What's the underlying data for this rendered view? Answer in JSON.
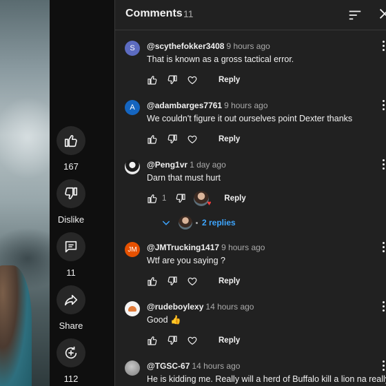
{
  "actions": {
    "like": {
      "label": "167"
    },
    "dislike": {
      "label": "Dislike"
    },
    "comments": {
      "label": "11"
    },
    "share": {
      "label": "Share"
    },
    "remix": {
      "label": "112"
    }
  },
  "panel": {
    "title": "Comments",
    "count": "11"
  },
  "comments": [
    {
      "handle": "@scythefokker3408",
      "time": "9 hours ago",
      "text": "That is known as a gross tactical error.",
      "avatar_letter": "S",
      "avatar_color": "#5c6bc0",
      "reply_label": "Reply"
    },
    {
      "handle": "@adambarges7761",
      "time": "9 hours ago",
      "text": "We couldn't figure it out ourselves point Dexter thanks",
      "avatar_letter": "A",
      "avatar_color": "#1565c0",
      "reply_label": "Reply"
    },
    {
      "handle": "@Peng1vr",
      "time": "1 day ago",
      "text": "Darn that must hurt",
      "like_count": "1",
      "reply_label": "Reply",
      "replies_label": "2 replies"
    },
    {
      "handle": "@JMTrucking1417",
      "time": "9 hours ago",
      "text": "Wtf are you saying ?",
      "avatar_letter": "JM",
      "avatar_color": "#e65100",
      "reply_label": "Reply"
    },
    {
      "handle": "@rudeboylexy",
      "time": "14 hours ago",
      "text": "Good 👍",
      "reply_label": "Reply"
    },
    {
      "handle": "@TGSC-67",
      "time": "14 hours ago",
      "text": "He is kidding me. Really will a herd of Buffalo kill a lion na really"
    }
  ],
  "colors": {
    "panel_bg": "#212121",
    "link_blue": "#3ea6ff",
    "muted": "#aaaaaa"
  }
}
